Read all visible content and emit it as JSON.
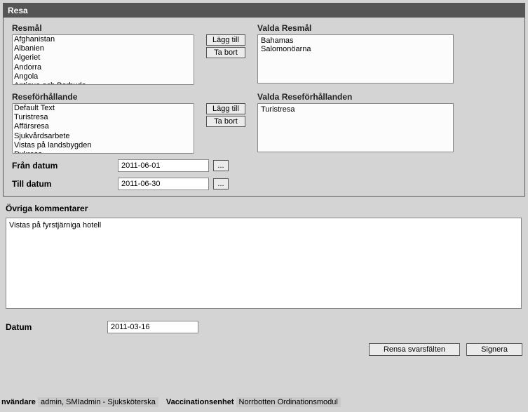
{
  "panel": {
    "title": "Resa"
  },
  "resmal": {
    "label": "Resmål",
    "options": [
      "Afghanistan",
      "Albanien",
      "Algeriet",
      "Andorra",
      "Angola",
      "Antigua och Barbuda"
    ]
  },
  "valda_resmal": {
    "label": "Valda Resmål",
    "items": [
      "Bahamas",
      "Salomonöarna"
    ]
  },
  "reseforhallande": {
    "label": "Reseförhållande",
    "options": [
      "Default Text",
      "Turistresa",
      "Affärsresa",
      "Sjukvårdsarbete",
      "Vistas på landsbygden",
      "Dykresa"
    ]
  },
  "valda_reseforhallanden": {
    "label": "Valda Reseförhållanden",
    "items": [
      "Turistresa"
    ]
  },
  "buttons": {
    "add": "Lägg till",
    "remove": "Ta bort",
    "datepick": "...",
    "clear": "Rensa svarsfälten",
    "sign": "Signera"
  },
  "fran_datum": {
    "label": "Från datum",
    "value": "2011-06-01"
  },
  "till_datum": {
    "label": "Till datum",
    "value": "2011-06-30"
  },
  "comments": {
    "label": "Övriga kommentarer",
    "value": "Vistas på fyrstjärniga hotell"
  },
  "datum": {
    "label": "Datum",
    "value": "2011-03-16"
  },
  "status": {
    "user_label": "nvändare",
    "user_value": "admin, SMIadmin - Sjuksköterska",
    "unit_label": "Vaccinationsenhet",
    "unit_value": "Norrbotten Ordinationsmodul"
  }
}
